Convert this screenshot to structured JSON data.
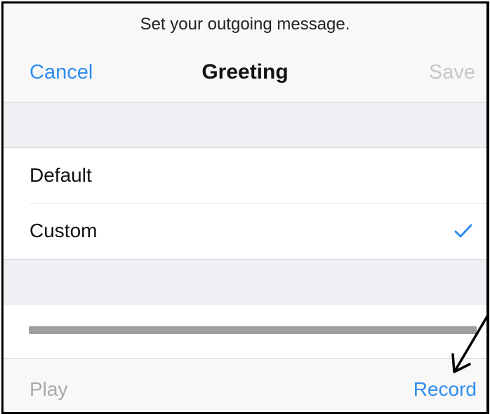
{
  "prompt": "Set your outgoing message.",
  "navbar": {
    "cancel_label": "Cancel",
    "title": "Greeting",
    "save_label": "Save"
  },
  "options": [
    {
      "label": "Default",
      "selected": false
    },
    {
      "label": "Custom",
      "selected": true
    }
  ],
  "toolbar": {
    "play_label": "Play",
    "record_label": "Record"
  },
  "colors": {
    "accent": "#2f8df0",
    "disabled": "#c8c8cc",
    "annotation_arrow": "#000000"
  },
  "icons": {
    "selected_marker": "checkmark-icon",
    "annotation": "arrow-icon"
  }
}
